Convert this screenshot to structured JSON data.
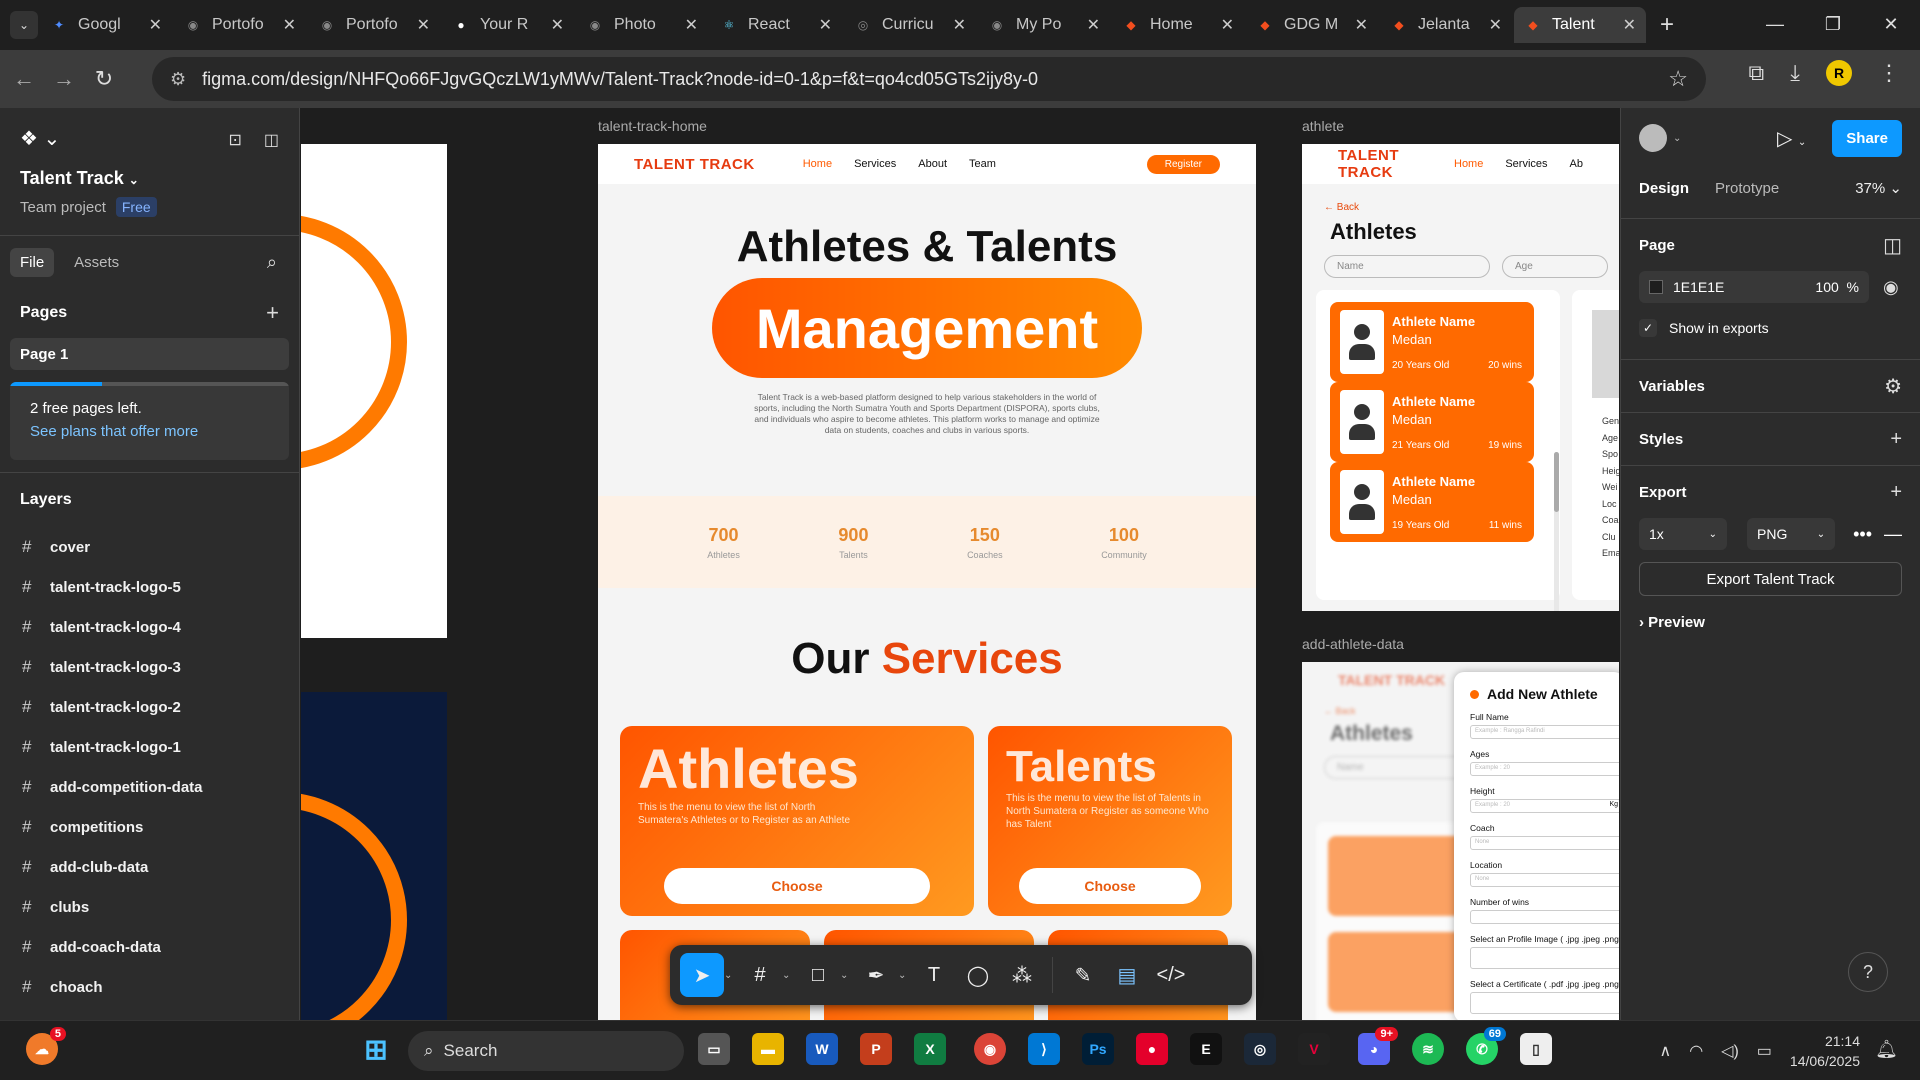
{
  "browser": {
    "tabs": [
      {
        "title": "Googl",
        "color": "#4f8cff",
        "glyph": "✦"
      },
      {
        "title": "Portofo",
        "color": "#888888",
        "glyph": "◉"
      },
      {
        "title": "Portofo",
        "color": "#888888",
        "glyph": "◉"
      },
      {
        "title": "Your R",
        "color": "#ffffff",
        "glyph": "●"
      },
      {
        "title": "Photo",
        "color": "#888888",
        "glyph": "◉"
      },
      {
        "title": "React",
        "color": "#61dafb",
        "glyph": "⚛"
      },
      {
        "title": "Curricu",
        "color": "#888888",
        "glyph": "◎"
      },
      {
        "title": "My Po",
        "color": "#888888",
        "glyph": "◉"
      },
      {
        "title": "Home",
        "color": "#f24e1e",
        "glyph": "◆"
      },
      {
        "title": "GDG M",
        "color": "#f24e1e",
        "glyph": "◆"
      },
      {
        "title": "Jelanta",
        "color": "#f24e1e",
        "glyph": "◆"
      },
      {
        "title": "Talent",
        "color": "#f24e1e",
        "glyph": "◆"
      }
    ],
    "url": "figma.com/design/NHFQo66FJgvGQczLW1yMWv/Talent-Track?node-id=0-1&p=f&t=qo4cd05GTs2ijy8y-0",
    "profile_initial": "R"
  },
  "left_panel": {
    "project_name": "Talent Track",
    "project_sub": "Team project",
    "plan_badge": "Free",
    "tabs": [
      "File",
      "Assets"
    ],
    "pages_heading": "Pages",
    "current_page": "Page 1",
    "upsell_text": "2 free pages left.",
    "upsell_link": "See plans that offer more",
    "layers_heading": "Layers",
    "layers": [
      "cover",
      "talent-track-logo-5",
      "talent-track-logo-4",
      "talent-track-logo-3",
      "talent-track-logo-2",
      "talent-track-logo-1",
      "add-competition-data",
      "competitions",
      "add-club-data",
      "clubs",
      "add-coach-data",
      "choach"
    ]
  },
  "canvas": {
    "home_label": "talent-track-home",
    "athlete_label": "athlete",
    "add_label": "add-athlete-data",
    "home": {
      "brand": "TALENT TRACK",
      "nav": [
        "Home",
        "Services",
        "About",
        "Team"
      ],
      "register": "Register",
      "hero_line1": "Athletes & Talents",
      "hero_pill": "Management",
      "hero_desc": "Talent Track is a web-based platform designed to help various stakeholders in the world of sports, including the North Sumatra Youth and Sports Department (DISPORA), sports clubs, and individuals who aspire to become athletes. This platform works to manage and optimize data on students, coaches and clubs in various sports.",
      "stats": [
        {
          "value": "700",
          "label": "Athletes"
        },
        {
          "value": "900",
          "label": "Talents"
        },
        {
          "value": "150",
          "label": "Coaches"
        },
        {
          "value": "100",
          "label": "Community"
        }
      ],
      "services_title_a": "Our",
      "services_title_b": "Services",
      "cards": [
        {
          "title": "Athletes",
          "desc": "This is the menu to view the list of North Sumatera's Athletes or to Register as an Athlete",
          "button": "Choose"
        },
        {
          "title": "Talents",
          "desc": "This is the menu to view the list of Talents in North Sumatera or Register as someone Who has Talent",
          "button": "Choose"
        }
      ]
    },
    "athlete": {
      "brand": "TALENT TRACK",
      "nav": [
        "Home",
        "Services",
        "Ab"
      ],
      "back": "Back",
      "title": "Athletes",
      "filter_name": "Name",
      "filter_age": "Age",
      "cards": [
        {
          "name": "Athlete Name",
          "city": "Medan",
          "age": "20 Years Old",
          "wins": "20 wins"
        },
        {
          "name": "Athlete Name",
          "city": "Medan",
          "age": "21 Years Old",
          "wins": "19 wins"
        },
        {
          "name": "Athlete Name",
          "city": "Medan",
          "age": "19 Years Old",
          "wins": "11 wins"
        }
      ],
      "detail_fields": [
        "Gen",
        "Age",
        "Spo",
        "Heig",
        "Wei",
        "Loc",
        "Coa",
        "Clu",
        "Ema"
      ]
    },
    "add_athlete": {
      "brand": "TALENT TRACK",
      "back": "Back",
      "title": "Athletes",
      "filter_name": "Name",
      "modal_title": "Add New Athlete",
      "fields": [
        {
          "label": "Full Name",
          "placeholder": "Example : Rangga Rafindi"
        },
        {
          "label": "Ages",
          "placeholder": "Example : 20"
        },
        {
          "label": "Height",
          "placeholder": "Example : 20"
        },
        {
          "label": "Coach",
          "placeholder": "None"
        },
        {
          "label": "Location",
          "placeholder": "None"
        },
        {
          "label": "Number of wins",
          "placeholder": ""
        },
        {
          "label": "Select an Profile Image ( .jpg .jpeg .png",
          "placeholder": ""
        },
        {
          "label": "Select a Certificate ( .pdf .jpg .jpeg .png",
          "placeholder": ""
        }
      ],
      "height_unit": "Kg"
    }
  },
  "right_panel": {
    "share": "Share",
    "tabs": [
      "Design",
      "Prototype"
    ],
    "zoom": "37%",
    "page_heading": "Page",
    "bg_color": "1E1E1E",
    "bg_opacity": "100",
    "opacity_unit": "%",
    "show_in_exports": "Show in exports",
    "variables": "Variables",
    "styles": "Styles",
    "export": "Export",
    "export_scale": "1x",
    "export_format": "PNG",
    "export_button": "Export Talent Track",
    "preview": "Preview"
  },
  "taskbar": {
    "search": "Search",
    "weather_badge": "5",
    "whatsapp_badge": "69",
    "discord_badge": "9+",
    "time": "21:14",
    "date": "14/06/2025"
  }
}
